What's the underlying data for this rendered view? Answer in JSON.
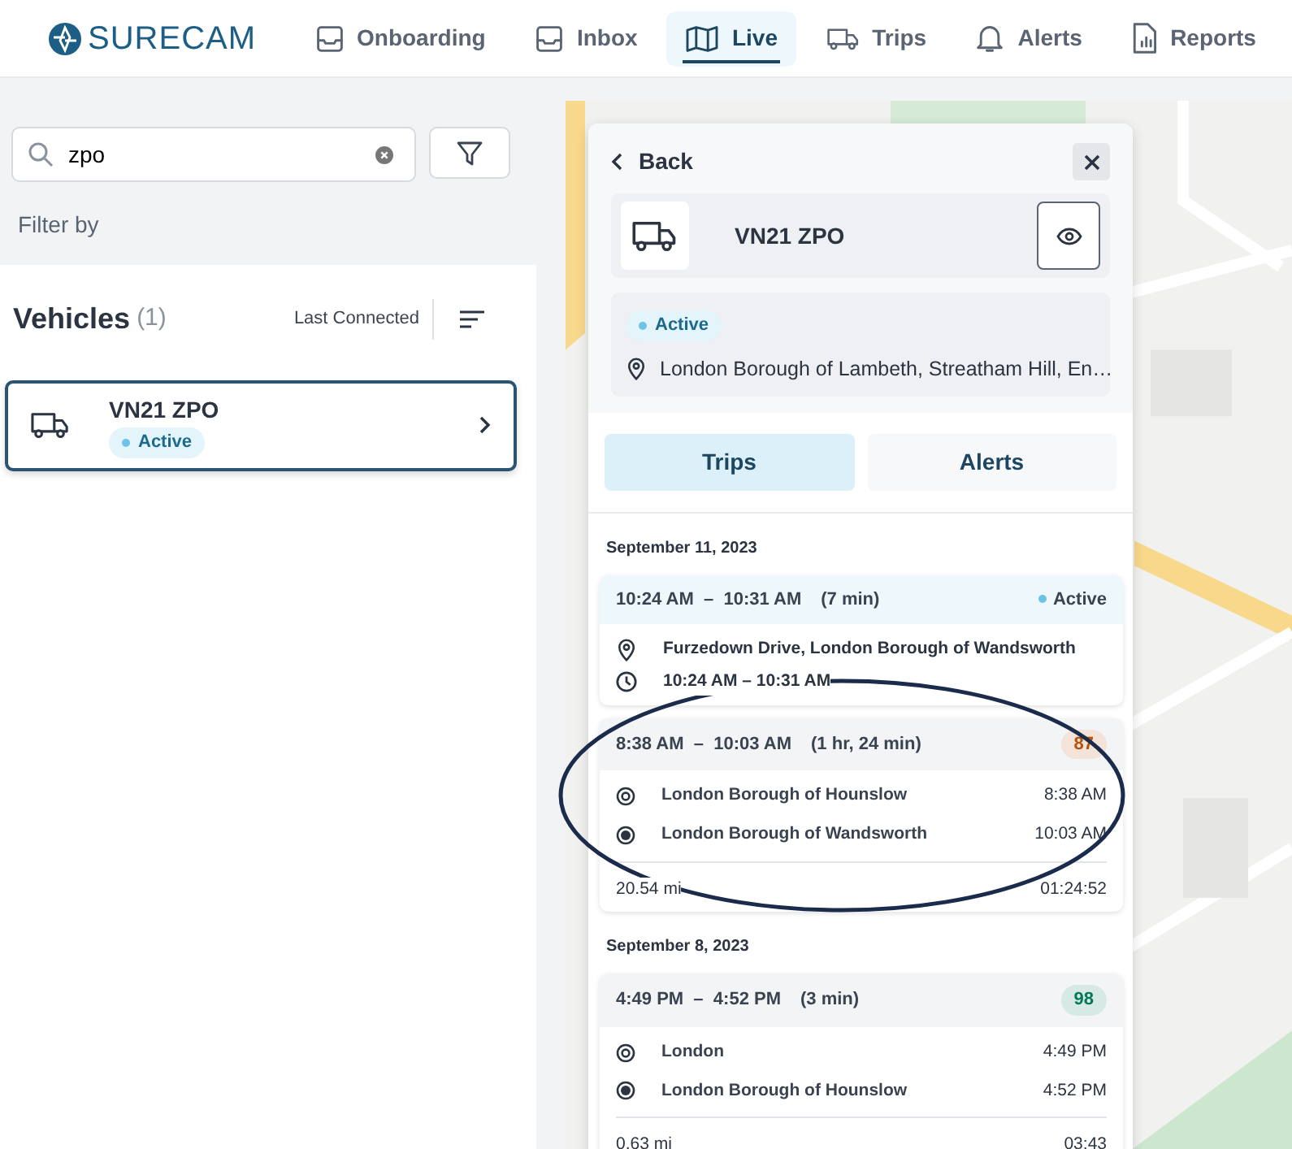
{
  "brand": {
    "name": "SURECAM"
  },
  "nav": [
    {
      "label": "Onboarding",
      "selected": false
    },
    {
      "label": "Inbox",
      "selected": false
    },
    {
      "label": "Live",
      "selected": true
    },
    {
      "label": "Trips",
      "selected": false
    },
    {
      "label": "Alerts",
      "selected": false
    },
    {
      "label": "Reports",
      "selected": false
    }
  ],
  "search": {
    "value": "zpo"
  },
  "filter_label": "Filter by",
  "vehicles": {
    "title": "Vehicles",
    "count": "(1)",
    "sort": "Last Connected",
    "items": [
      {
        "name": "VN21 ZPO",
        "status": "Active",
        "selected": true
      }
    ]
  },
  "detail": {
    "back": "Back",
    "vehicle": "VN21 ZPO",
    "status": "Active",
    "location": "London Borough of Lambeth, Streatham Hill, En…",
    "tabs": [
      {
        "label": "Trips",
        "selected": true
      },
      {
        "label": "Alerts",
        "selected": false
      }
    ],
    "days": [
      {
        "date": "September 11, 2023",
        "trips": [
          {
            "kind": "active",
            "time": "10:24 AM  –  10:31 AM",
            "duration": "(7 min)",
            "status": "Active",
            "place": "Furzedown Drive, London Borough of Wandsworth",
            "range": "10:24 AM – 10:31 AM"
          },
          {
            "kind": "done",
            "time": "8:38 AM  –  10:03 AM",
            "duration": "(1 hr, 24 min)",
            "score": "87",
            "color": "#b45309",
            "from": "London Borough of Hounslow",
            "from_time": "8:38 AM",
            "to": "London Borough of Wandsworth",
            "to_time": "10:03 AM",
            "distance": "20.54 mi",
            "elapsed": "01:24:52"
          }
        ]
      },
      {
        "date": "September 8, 2023",
        "trips": [
          {
            "kind": "done",
            "time": "4:49 PM  –  4:52 PM",
            "duration": "(3 min)",
            "score": "98",
            "color": "#047857",
            "from": "London",
            "from_time": "4:49 PM",
            "to": "London Borough of Hounslow",
            "to_time": "4:52 PM",
            "distance": "0.63 mi",
            "elapsed": "03:43"
          }
        ]
      }
    ]
  }
}
